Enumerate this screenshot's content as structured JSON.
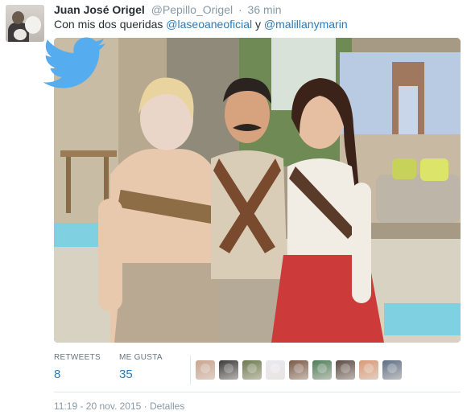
{
  "tweet": {
    "author_name": "Juan José Origel",
    "author_handle": "@Pepillo_Origel",
    "separator": "·",
    "time_ago": "36 min",
    "text_prefix": "Con mis dos queridas ",
    "mention_1": "@laseoaneoficial",
    "text_middle": " y ",
    "mention_2": "@malillanymarin"
  },
  "stats": {
    "retweets_label": "RETWEETS",
    "retweets_count": "8",
    "likes_label": "ME GUSTA",
    "likes_count": "35"
  },
  "favoriters": [
    {
      "name": "favoriter-avatar-1",
      "color": "#c9a58f"
    },
    {
      "name": "favoriter-avatar-2",
      "color": "#3c3c3c"
    },
    {
      "name": "favoriter-avatar-3",
      "color": "#6d7a4e"
    },
    {
      "name": "favoriter-avatar-4",
      "color": "#e9e9ef"
    },
    {
      "name": "favoriter-avatar-5",
      "color": "#7a5a48"
    },
    {
      "name": "favoriter-avatar-6",
      "color": "#4f7d5a"
    },
    {
      "name": "favoriter-avatar-7",
      "color": "#5a4a44"
    },
    {
      "name": "favoriter-avatar-8",
      "color": "#d99a78"
    },
    {
      "name": "favoriter-avatar-9",
      "color": "#5f6f86"
    }
  ],
  "footer": {
    "timestamp": "11:19 - 20 nov. 2015",
    "separator": "·",
    "details_link": "Detalles"
  },
  "colors": {
    "link": "#2b7bb9",
    "muted": "#8899a6",
    "text": "#292f33",
    "twitter_blue": "#55acee"
  },
  "icons": {
    "twitter_logo": "twitter-bird-icon"
  }
}
